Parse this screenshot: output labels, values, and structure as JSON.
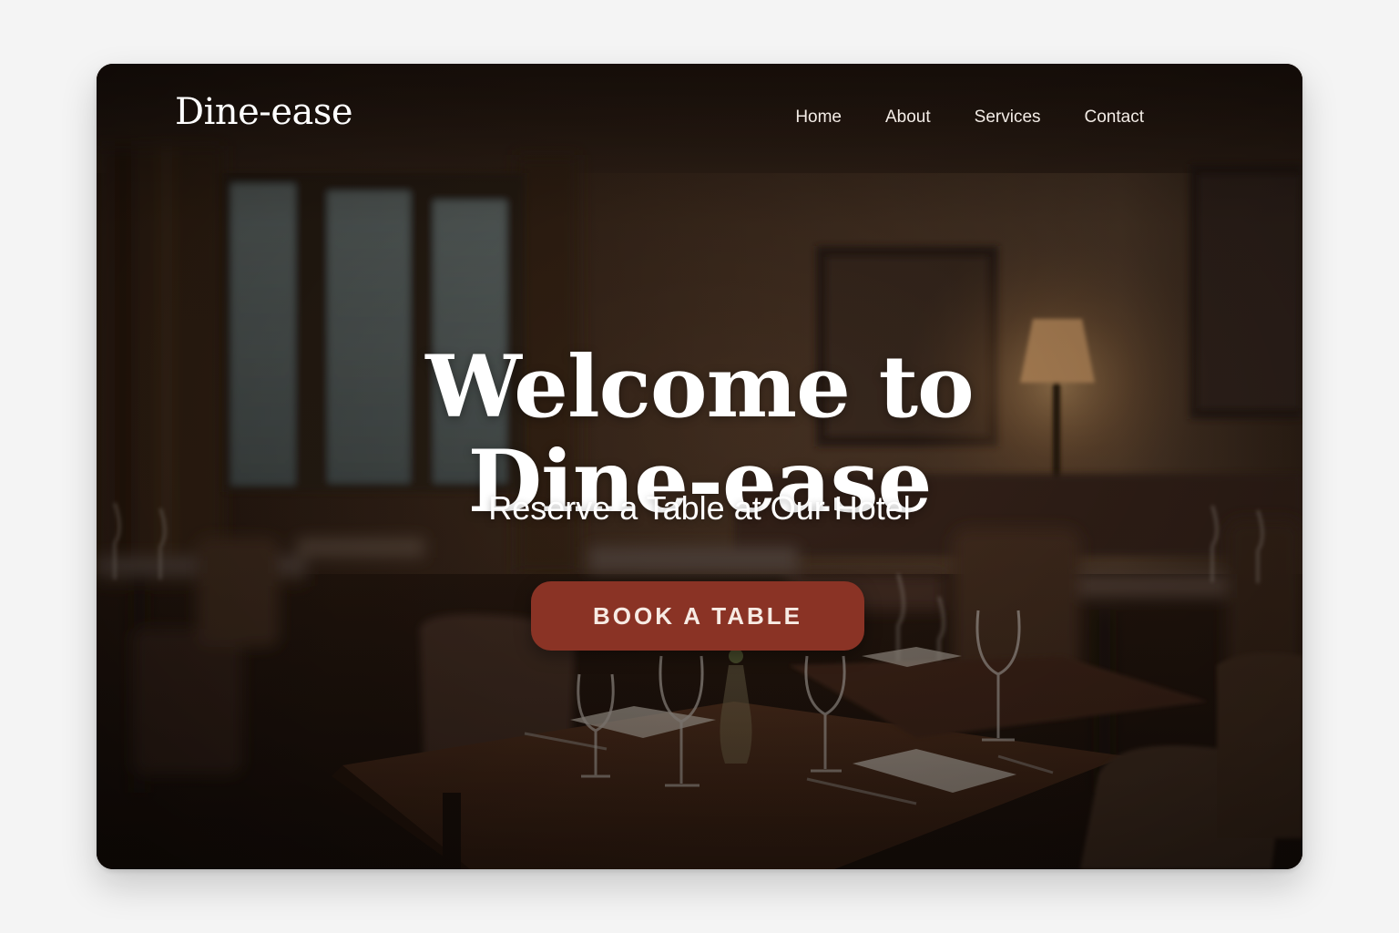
{
  "header": {
    "brand": "Dine-ease",
    "nav": [
      {
        "label": "Home"
      },
      {
        "label": "About"
      },
      {
        "label": "Services"
      },
      {
        "label": "Contact"
      }
    ]
  },
  "hero": {
    "title_line1": "Welcome to",
    "title_line2": "Dine-ease",
    "subtitle": "Reserve a Table at Our Hotel",
    "cta_label": "BOOK A TABLE"
  },
  "colors": {
    "cta_background": "#8a3325",
    "text": "#ffffff",
    "scene_dark": "#2a1b13"
  }
}
